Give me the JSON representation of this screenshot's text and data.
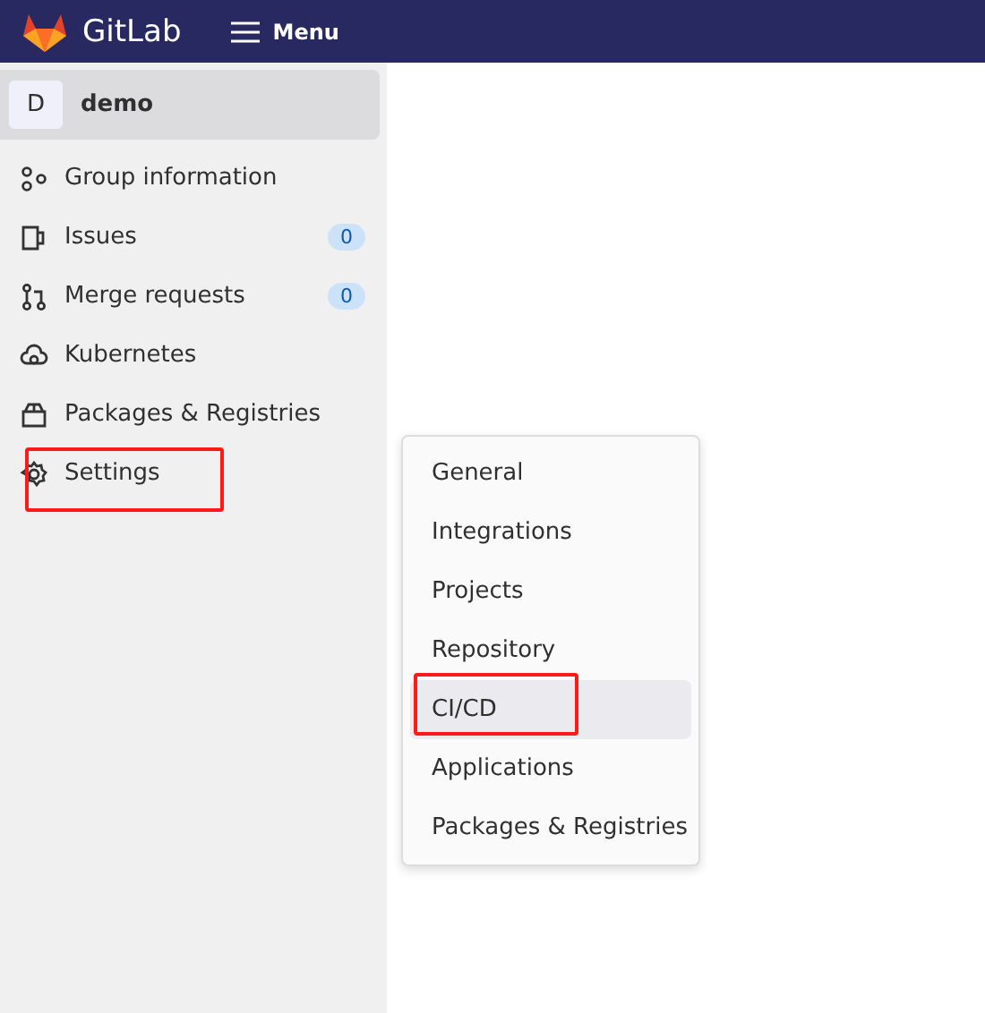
{
  "header": {
    "logo_text": "GitLab",
    "menu_label": "Menu"
  },
  "sidebar": {
    "group": {
      "avatar": "D",
      "name": "demo"
    },
    "items": [
      {
        "label": "Group information",
        "annotated": false
      },
      {
        "label": "Issues",
        "count": "0",
        "annotated": false
      },
      {
        "label": "Merge requests",
        "count": "0",
        "annotated": false
      },
      {
        "label": "Kubernetes",
        "annotated": false
      },
      {
        "label": "Packages & Registries",
        "annotated": false
      },
      {
        "label": "Settings",
        "annotated": true
      }
    ]
  },
  "flyout": {
    "items": [
      {
        "label": "General",
        "selected": false,
        "annotated": false
      },
      {
        "label": "Integrations",
        "selected": false,
        "annotated": false
      },
      {
        "label": "Projects",
        "selected": false,
        "annotated": false
      },
      {
        "label": "Repository",
        "selected": false,
        "annotated": false
      },
      {
        "label": "CI/CD",
        "selected": true,
        "annotated": true
      },
      {
        "label": "Applications",
        "selected": false,
        "annotated": false
      },
      {
        "label": "Packages & Registries",
        "selected": false,
        "annotated": false
      }
    ]
  }
}
